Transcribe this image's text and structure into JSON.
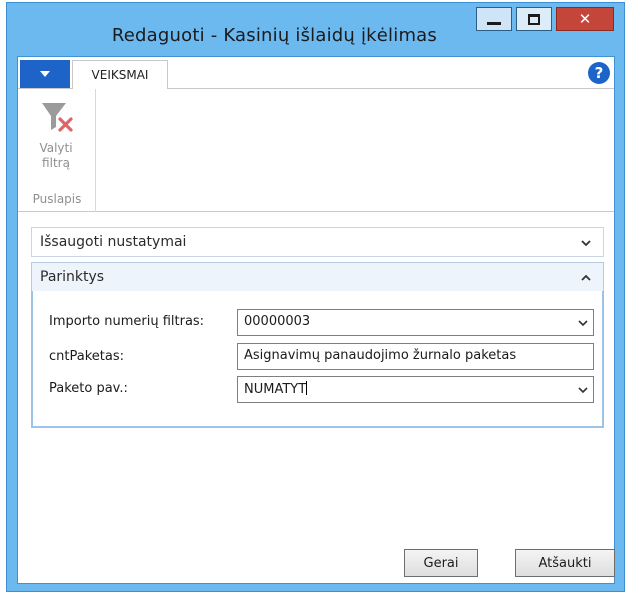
{
  "window": {
    "title": "Redaguoti - Kasinių išlaidų įkėlimas"
  },
  "ribbon": {
    "tabs": [
      {
        "label": "VEIKSMAI"
      }
    ],
    "actions": [
      {
        "label_line1": "Valyti",
        "label_line2": "filtrą",
        "icon": "clear-filter-icon"
      }
    ],
    "group_label": "Puslapis"
  },
  "fasttabs": {
    "saved_settings": {
      "title": "Išsaugoti nustatymai",
      "state": "collapsed"
    },
    "options": {
      "title": "Parinktys",
      "state": "expanded"
    }
  },
  "form": {
    "fields": [
      {
        "label": "Importo numerių filtras:",
        "value": "00000003",
        "dropdown": true
      },
      {
        "label": "cntPaketas:",
        "value": "Asignavimų panaudojimo žurnalo paketas",
        "dropdown": false
      },
      {
        "label": "Paketo pav.:",
        "value": "NUMATYT",
        "dropdown": true
      }
    ]
  },
  "buttons": {
    "ok": "Gerai",
    "cancel": "Atšaukti"
  },
  "colors": {
    "accent": "#1e63c8",
    "close": "#c4453a",
    "frame": "#6cb9f0"
  }
}
